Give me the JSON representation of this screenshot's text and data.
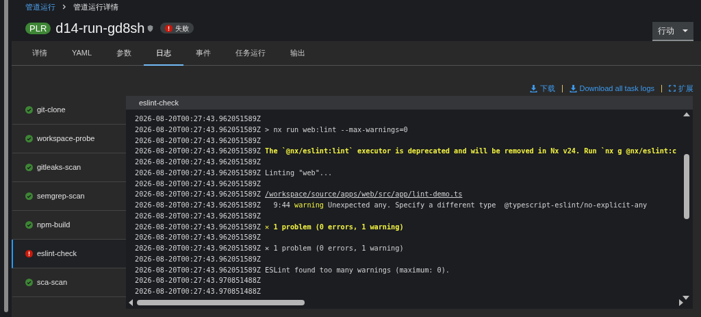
{
  "breadcrumb": [
    {
      "label": "管道运行",
      "kind": "link"
    },
    {
      "label": "管道运行详情",
      "kind": "current"
    }
  ],
  "header": {
    "badge": "PLR",
    "title": "d14-run-gd8sh",
    "status": {
      "kind": "failed",
      "label": "失败"
    },
    "actions_button": "行动"
  },
  "tabs": [
    {
      "label": "详情",
      "selected": false
    },
    {
      "label": "YAML",
      "selected": false
    },
    {
      "label": "参数",
      "selected": false
    },
    {
      "label": "日志",
      "selected": true
    },
    {
      "label": "事件",
      "selected": false
    },
    {
      "label": "任务运行",
      "selected": false
    },
    {
      "label": "输出",
      "selected": false
    }
  ],
  "toolbar": [
    {
      "kind": "download",
      "label": "下载"
    },
    {
      "kind": "download",
      "label": "Download all task logs"
    },
    {
      "kind": "expand",
      "label": "扩展"
    }
  ],
  "tasks": [
    {
      "name": "git-clone",
      "kind": "success",
      "selected": false
    },
    {
      "name": "workspace-probe",
      "kind": "success",
      "selected": false
    },
    {
      "name": "gitleaks-scan",
      "kind": "success",
      "selected": false
    },
    {
      "name": "semgrep-scan",
      "kind": "success",
      "selected": false
    },
    {
      "name": "npm-build",
      "kind": "success",
      "selected": false
    },
    {
      "name": "eslint-check",
      "kind": "failed",
      "selected": true
    },
    {
      "name": "sca-scan",
      "kind": "success",
      "selected": false
    }
  ],
  "log": {
    "title": "eslint-check",
    "lines": [
      {
        "timestamp": "2026-08-20T00:27:43.962051589Z"
      },
      {
        "timestamp": "2026-08-20T00:27:43.962051589Z",
        "segments": [
          {
            "text": "> nx run web:lint --max-warnings=0",
            "kind": "plain"
          }
        ]
      },
      {
        "timestamp": "2026-08-20T00:27:43.962051589Z"
      },
      {
        "timestamp": "2026-08-20T00:27:43.962051589Z",
        "segments": [
          {
            "text": "The `@nx/eslint:lint` executor is deprecated and will be removed in Nx v24. Run `nx g @nx/eslint:c",
            "kind": "warning-bold"
          }
        ]
      },
      {
        "timestamp": "2026-08-20T00:27:43.962051589Z"
      },
      {
        "timestamp": "2026-08-20T00:27:43.962051589Z",
        "segments": [
          {
            "text": "Linting \"web\"...",
            "kind": "plain"
          }
        ]
      },
      {
        "timestamp": "2026-08-20T00:27:43.962051589Z"
      },
      {
        "timestamp": "2026-08-20T00:27:43.962051589Z",
        "segments": [
          {
            "text": "/workspace/source/apps/web/src/app/lint-demo.ts",
            "kind": "path"
          }
        ]
      },
      {
        "timestamp": "2026-08-20T00:27:43.962051589Z",
        "segments": [
          {
            "text": "  9:44",
            "kind": "plain"
          },
          {
            "text": "warning",
            "kind": "warning"
          },
          {
            "text": "Unexpected any. Specify a different type  @typescript-eslint/no-explicit-any",
            "kind": "plain"
          }
        ]
      },
      {
        "timestamp": "2026-08-20T00:27:43.962051589Z"
      },
      {
        "timestamp": "2026-08-20T00:27:43.962051589Z",
        "segments": [
          {
            "text": "✕ 1 problem (0 errors, 1 warning)",
            "kind": "warning-bold"
          }
        ]
      },
      {
        "timestamp": "2026-08-20T00:27:43.962051589Z"
      },
      {
        "timestamp": "2026-08-20T00:27:43.962051589Z",
        "segments": [
          {
            "text": "✕ 1 problem (0 errors, 1 warning)",
            "kind": "plain"
          }
        ]
      },
      {
        "timestamp": "2026-08-20T00:27:43.962051589Z"
      },
      {
        "timestamp": "2026-08-20T00:27:43.962051589Z",
        "segments": [
          {
            "text": "ESLint found too many warnings (maximum: 0).",
            "kind": "plain"
          }
        ]
      },
      {
        "timestamp": "2026-08-20T00:27:43.970851488Z"
      },
      {
        "timestamp": "2026-08-20T00:27:43.970851488Z"
      }
    ]
  }
}
